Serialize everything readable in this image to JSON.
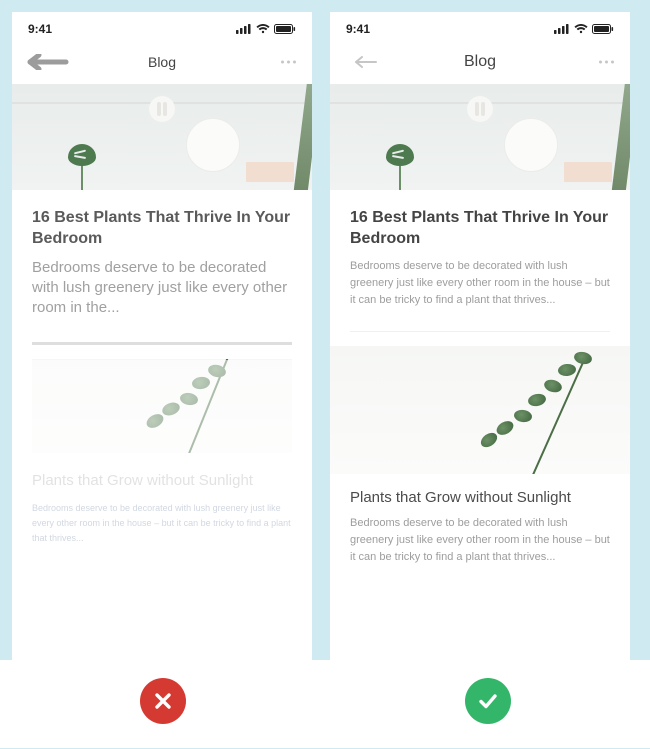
{
  "status": {
    "time": "9:41"
  },
  "nav": {
    "title": "Blog"
  },
  "post1": {
    "title": "16 Best Plants That Thrive In Your Bedroom",
    "excerpt_short": "Bedrooms deserve to be decorated with lush greenery just like every other room in the...",
    "excerpt_long": "Bedrooms deserve to be decorated with lush greenery just like every other room in the house – but it can be tricky to find a plant that thrives..."
  },
  "post2": {
    "title": "Plants that Grow without Sunlight",
    "excerpt": "Bedrooms deserve to be decorated with lush greenery just like every other room in the house – but it can be tricky to find a plant that thrives..."
  }
}
